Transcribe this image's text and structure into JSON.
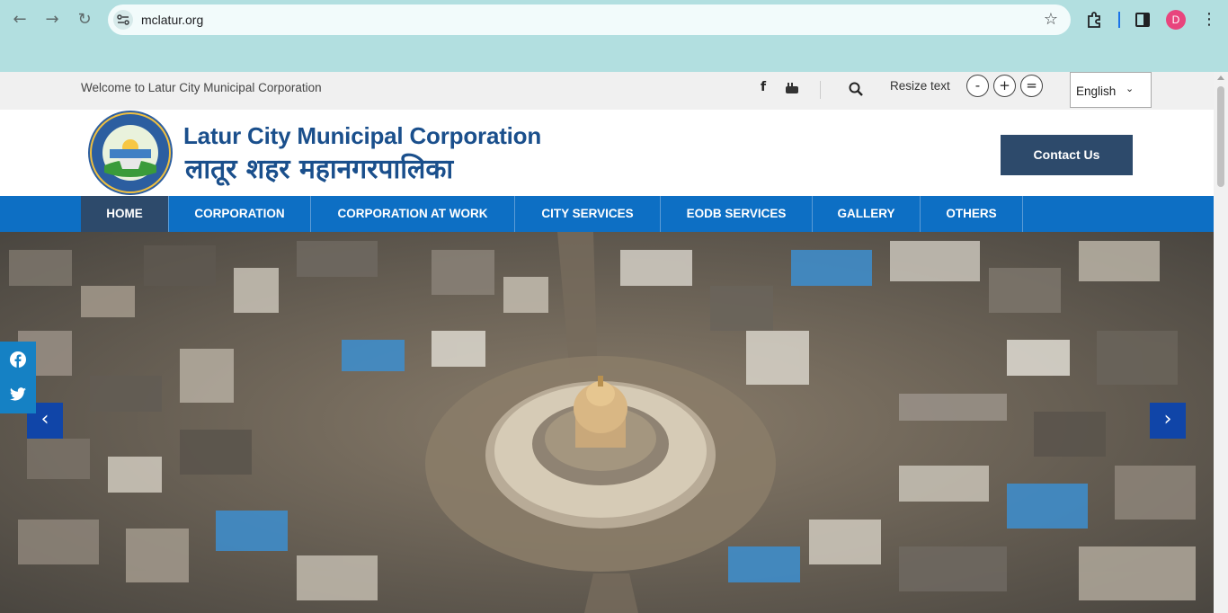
{
  "browser": {
    "url": "mclatur.org",
    "avatar_letter": "D",
    "accent_color": "#b2dfe0"
  },
  "topbar": {
    "welcome": "Welcome to Latur City Municipal Corporation",
    "social_icons": [
      "facebook-icon",
      "youtube-icon"
    ],
    "resize_label": "Resize text",
    "resize_buttons": [
      "-",
      "+",
      "="
    ],
    "language": "English"
  },
  "header": {
    "title_en": "Latur City Municipal Corporation",
    "title_mr": "लातूर शहर महानगरपालिका",
    "contact_label": "Contact Us"
  },
  "nav": {
    "items": [
      {
        "label": "HOME",
        "active": true
      },
      {
        "label": "CORPORATION",
        "active": false
      },
      {
        "label": "CORPORATION AT WORK",
        "active": false
      },
      {
        "label": "CITY SERVICES",
        "active": false
      },
      {
        "label": "EODB SERVICES",
        "active": false
      },
      {
        "label": "GALLERY",
        "active": false
      },
      {
        "label": "OTHERS",
        "active": false
      }
    ],
    "bar_color": "#0d6fc4",
    "active_color": "#2d4a6b"
  },
  "hero": {
    "image": "aerial city view with domed temple roundabout",
    "prev_icon": "chevron-left-icon",
    "next_icon": "chevron-right-icon"
  },
  "share": {
    "items": [
      "facebook-icon",
      "twitter-icon"
    ]
  }
}
